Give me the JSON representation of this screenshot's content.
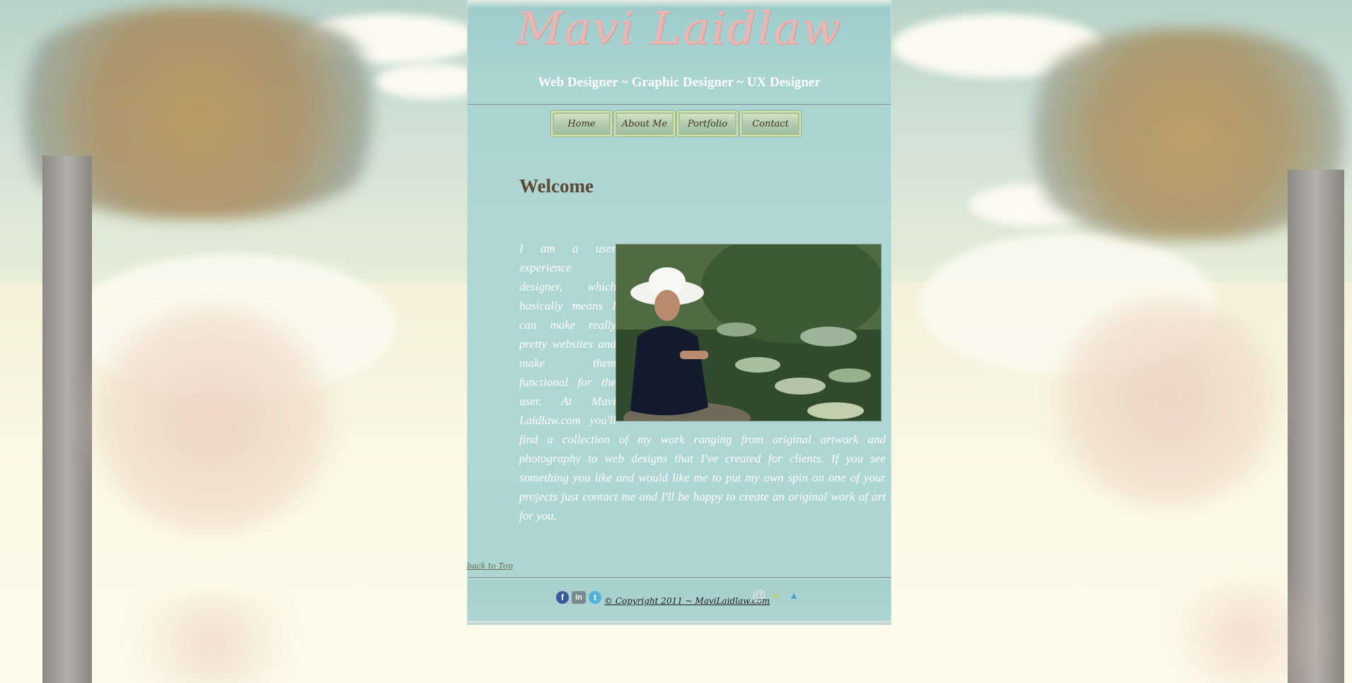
{
  "site": {
    "logo": "Mavi Laidlaw",
    "tagline": "Web Designer ~ Graphic Designer ~ UX Designer"
  },
  "nav": {
    "items": [
      {
        "label": "Home"
      },
      {
        "label": "About Me"
      },
      {
        "label": "Portfolio"
      },
      {
        "label": "Contact"
      }
    ]
  },
  "main": {
    "heading": "Welcome",
    "body": "I am a user experience designer, which basically means I can make really pretty websites and make them functional for the user. At Mavi Laidlaw.com you'll find a collection of my work ranging from original artwork and photography to web designs that I've created for clients. If you see something you like and would like me to put my own spin on one of your projects just contact me and I'll be happy to create an original work of art for you.",
    "photo_icon": "portrait-photo"
  },
  "footer": {
    "back_to_top": "back to Top",
    "copyright": "© Copyright 2011 ~ MaviLaidlaw.com",
    "social": [
      {
        "name": "facebook-icon",
        "glyph": "f",
        "color": "#3b5998"
      },
      {
        "name": "linkedin-icon",
        "glyph": "in",
        "color": "#7a8b90"
      },
      {
        "name": "twitter-icon",
        "glyph": "t",
        "color": "#4fb4d8"
      }
    ],
    "extra": [
      {
        "name": "email-icon",
        "glyph": "@",
        "color": "#d7d7d7"
      },
      {
        "name": "link-icon",
        "glyph": "∞",
        "color": "#b9cf7a"
      },
      {
        "name": "profile-icon",
        "glyph": "▲",
        "color": "#4aa3c9"
      }
    ]
  },
  "colors": {
    "panel": "#acd5d3",
    "heading": "#5a4a35",
    "logo": "#e9b6b3",
    "text": "#ffffff"
  }
}
